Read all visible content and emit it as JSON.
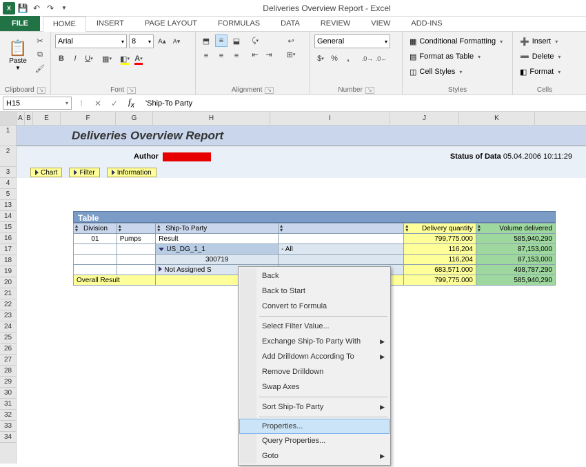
{
  "window": {
    "title": "Deliveries Overview Report - Excel"
  },
  "tabs": {
    "file": "FILE",
    "home": "HOME",
    "insert": "INSERT",
    "pagelayout": "PAGE LAYOUT",
    "formulas": "FORMULAS",
    "data": "DATA",
    "review": "REVIEW",
    "view": "VIEW",
    "addins": "ADD-INS"
  },
  "ribbon": {
    "clipboard": {
      "label": "Clipboard",
      "paste": "Paste"
    },
    "font": {
      "label": "Font",
      "name": "Arial",
      "size": "8"
    },
    "alignment": {
      "label": "Alignment"
    },
    "number": {
      "label": "Number",
      "format": "General"
    },
    "styles": {
      "label": "Styles",
      "cond": "Conditional Formatting",
      "table": "Format as Table",
      "cell": "Cell Styles"
    },
    "cells": {
      "label": "Cells",
      "insert": "Insert",
      "delete": "Delete",
      "format": "Format"
    }
  },
  "formula_bar": {
    "cell": "H15",
    "value": "'Ship-To Party"
  },
  "columns": [
    "A",
    "B",
    "E",
    "F",
    "G",
    "H",
    "I",
    "J",
    "K"
  ],
  "row_labels": [
    "1",
    "2",
    "3",
    "4",
    "5",
    "13",
    "14",
    "15",
    "16",
    "17",
    "18",
    "19",
    "20",
    "21",
    "22",
    "23",
    "24",
    "25",
    "26",
    "27",
    "28",
    "29",
    "30",
    "31",
    "32",
    "33",
    "34"
  ],
  "report": {
    "title": "Deliveries Overview Report",
    "author_label": "Author",
    "status_label": "Status of Data",
    "status_value": "05.04.2006 10:11:29",
    "buttons": {
      "chart": "Chart",
      "filter": "Filter",
      "info": "Information"
    }
  },
  "table": {
    "title": "Table",
    "headers": {
      "division": "Division",
      "ship_to": "Ship-To Party",
      "customer": "",
      "dq": "Delivery quantity",
      "vd": "Volume delivered"
    },
    "rows": [
      {
        "division": "01",
        "divlabel": "Pumps",
        "ship": "Result",
        "cust": "",
        "dq": "799,775.000",
        "vd": "585,940,290"
      },
      {
        "division": "",
        "divlabel": "",
        "ship": "US_DG_1_1",
        "cust": "- All",
        "dq": "116,204",
        "vd": "87,153,000",
        "expand": "down",
        "sub": true
      },
      {
        "division": "",
        "divlabel": "",
        "ship": "300719",
        "cust": "",
        "dq": "116,204",
        "vd": "87,153,000",
        "sub": true
      },
      {
        "division": "",
        "divlabel": "",
        "ship": "Not Assigned S",
        "cust": "",
        "dq": "683,571.000",
        "vd": "498,787,290",
        "expand": "right",
        "sub": true
      }
    ],
    "total": {
      "label": "Overall Result",
      "dq": "799,775.000",
      "vd": "585,940,290"
    }
  },
  "context_menu": {
    "items": [
      {
        "label": "Back"
      },
      {
        "label": "Back to Start"
      },
      {
        "label": "Convert to Formula"
      },
      {
        "sep": true
      },
      {
        "label": "Select Filter Value..."
      },
      {
        "label": "Exchange Ship-To Party With",
        "sub": true
      },
      {
        "label": "Add Drilldown According To",
        "sub": true
      },
      {
        "label": "Remove Drilldown"
      },
      {
        "label": "Swap Axes"
      },
      {
        "sep": true
      },
      {
        "label": "Sort Ship-To Party",
        "sub": true
      },
      {
        "sep": true
      },
      {
        "label": "Properties...",
        "selected": true
      },
      {
        "label": "Query Properties..."
      },
      {
        "label": "Goto",
        "sub": true
      }
    ]
  }
}
